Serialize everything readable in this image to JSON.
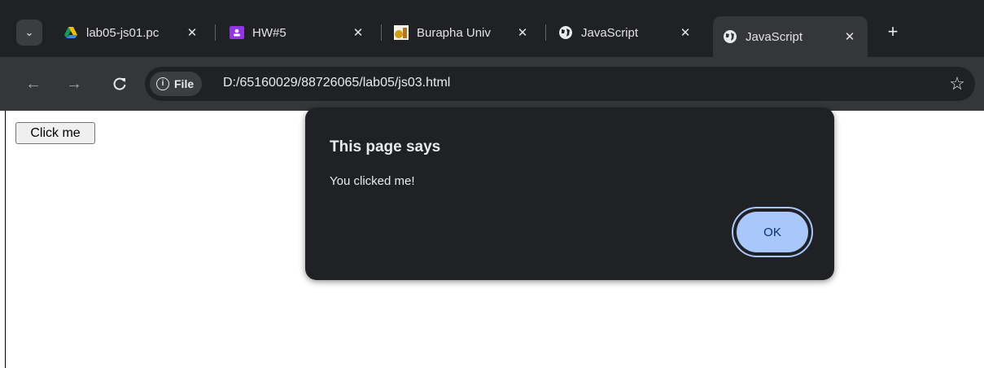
{
  "browser": {
    "tabs": [
      {
        "title": "lab05-js01.pc",
        "favicon": "google-drive-icon"
      },
      {
        "title": "HW#5",
        "favicon": "classroom-icon"
      },
      {
        "title": "Burapha Univ",
        "favicon": "burapha-logo-icon"
      },
      {
        "title": "JavaScript",
        "favicon": "globe-icon"
      },
      {
        "title": "JavaScript",
        "favicon": "globe-icon",
        "active": true
      }
    ],
    "close_glyph": "✕",
    "new_tab_glyph": "+",
    "omnibox": {
      "chip_label": "File",
      "url": "D:/65160029/88726065/lab05/js03.html"
    }
  },
  "page": {
    "button_label": "Click me"
  },
  "dialog": {
    "title": "This page says",
    "message": "You clicked me!",
    "ok_label": "OK"
  },
  "colors": {
    "tabstrip_bg": "#202124",
    "toolbar_bg": "#35363a",
    "dialog_bg": "#202124",
    "ok_button": "#a8c7fa"
  }
}
